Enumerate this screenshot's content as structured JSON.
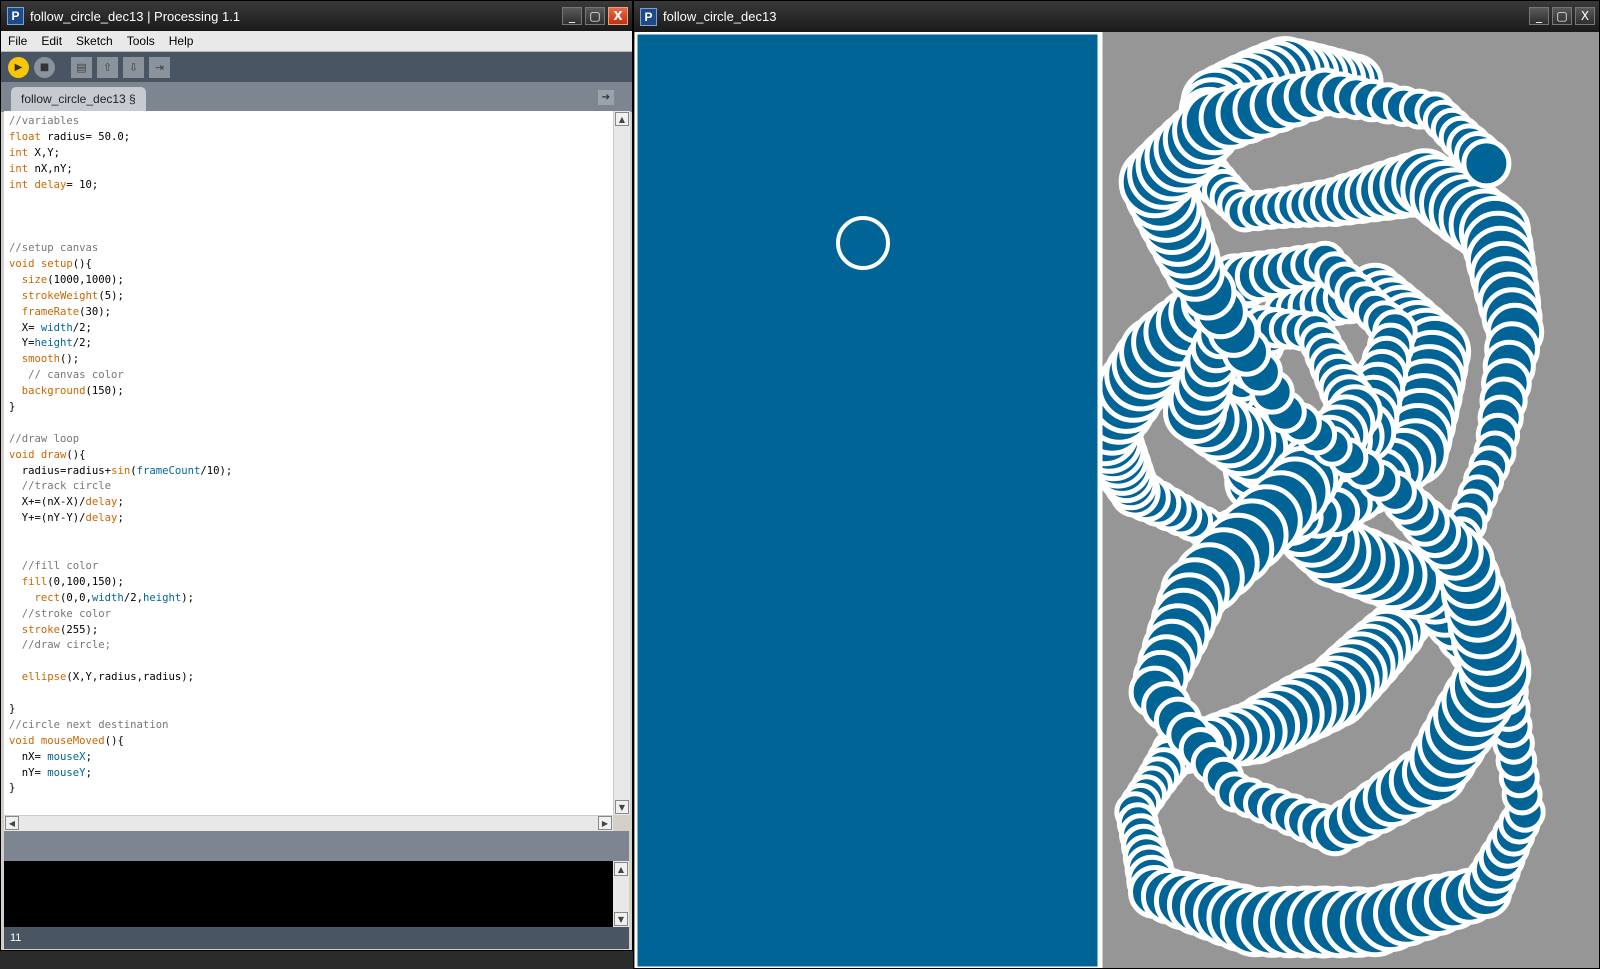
{
  "editor_window": {
    "title": "follow_circle_dec13 | Processing 1.1",
    "logo_letter": "P",
    "controls": {
      "minimize": "_",
      "maximize": "▢",
      "close": "X"
    },
    "menu": [
      "File",
      "Edit",
      "Sketch",
      "Tools",
      "Help"
    ],
    "toolbar": {
      "run": "▶",
      "stop": "■",
      "new": "▤",
      "open": "⇧",
      "save": "⇩",
      "export": "⇥"
    },
    "tab_label": "follow_circle_dec13 §",
    "tab_menu_glyph": "➔",
    "status_line_number": "11"
  },
  "code_lines": [
    [
      {
        "t": "//variables",
        "c": "c"
      }
    ],
    [
      {
        "t": "float",
        "c": "k"
      },
      {
        "t": " radius= 50.0;"
      }
    ],
    [
      {
        "t": "int",
        "c": "k"
      },
      {
        "t": " X,Y;"
      }
    ],
    [
      {
        "t": "int",
        "c": "k"
      },
      {
        "t": " nX,nY;"
      }
    ],
    [
      {
        "t": "int",
        "c": "k"
      },
      {
        "t": " delay",
        "c": "f"
      },
      {
        "t": "= 10;"
      }
    ],
    [],
    [],
    [],
    [
      {
        "t": "//setup canvas",
        "c": "c"
      }
    ],
    [
      {
        "t": "void",
        "c": "k"
      },
      {
        "t": " "
      },
      {
        "t": "setup",
        "c": "f"
      },
      {
        "t": "(){"
      }
    ],
    [
      {
        "t": "  "
      },
      {
        "t": "size",
        "c": "f"
      },
      {
        "t": "(1000,1000);"
      }
    ],
    [
      {
        "t": "  "
      },
      {
        "t": "strokeWeight",
        "c": "f"
      },
      {
        "t": "(5);"
      }
    ],
    [
      {
        "t": "  "
      },
      {
        "t": "frameRate",
        "c": "f"
      },
      {
        "t": "(30);"
      }
    ],
    [
      {
        "t": "  X= "
      },
      {
        "t": "width",
        "c": "v"
      },
      {
        "t": "/2;"
      }
    ],
    [
      {
        "t": "  Y="
      },
      {
        "t": "height",
        "c": "v"
      },
      {
        "t": "/2;"
      }
    ],
    [
      {
        "t": "  "
      },
      {
        "t": "smooth",
        "c": "f"
      },
      {
        "t": "();"
      }
    ],
    [
      {
        "t": "   // canvas color",
        "c": "c"
      }
    ],
    [
      {
        "t": "  "
      },
      {
        "t": "background",
        "c": "f"
      },
      {
        "t": "(150);"
      }
    ],
    [
      {
        "t": "}"
      }
    ],
    [],
    [
      {
        "t": "//draw loop",
        "c": "c"
      }
    ],
    [
      {
        "t": "void",
        "c": "k"
      },
      {
        "t": " "
      },
      {
        "t": "draw",
        "c": "f"
      },
      {
        "t": "(){"
      }
    ],
    [
      {
        "t": "  radius=radius+"
      },
      {
        "t": "sin",
        "c": "f"
      },
      {
        "t": "("
      },
      {
        "t": "frameCount",
        "c": "v"
      },
      {
        "t": "/10);"
      }
    ],
    [
      {
        "t": "  //track circle",
        "c": "c"
      }
    ],
    [
      {
        "t": "  X+=(nX-X)/"
      },
      {
        "t": "delay",
        "c": "f"
      },
      {
        "t": ";"
      }
    ],
    [
      {
        "t": "  Y+=(nY-Y)/"
      },
      {
        "t": "delay",
        "c": "f"
      },
      {
        "t": ";"
      }
    ],
    [],
    [],
    [
      {
        "t": "  //fill color",
        "c": "c"
      }
    ],
    [
      {
        "t": "  "
      },
      {
        "t": "fill",
        "c": "f"
      },
      {
        "t": "(0,100,150);"
      }
    ],
    [
      {
        "t": "    "
      },
      {
        "t": "rect",
        "c": "f"
      },
      {
        "t": "(0,0,"
      },
      {
        "t": "width",
        "c": "v"
      },
      {
        "t": "/2,"
      },
      {
        "t": "height",
        "c": "v"
      },
      {
        "t": ");"
      }
    ],
    [
      {
        "t": "  //stroke color",
        "c": "c"
      }
    ],
    [
      {
        "t": "  "
      },
      {
        "t": "stroke",
        "c": "f"
      },
      {
        "t": "(255);"
      }
    ],
    [
      {
        "t": "  //draw circle;",
        "c": "c"
      }
    ],
    [],
    [
      {
        "t": "  "
      },
      {
        "t": "ellipse",
        "c": "f"
      },
      {
        "t": "(X,Y,radius,radius);"
      }
    ],
    [],
    [
      {
        "t": "}"
      }
    ],
    [
      {
        "t": "//circle next destination",
        "c": "c"
      }
    ],
    [
      {
        "t": "void",
        "c": "k"
      },
      {
        "t": " "
      },
      {
        "t": "mouseMoved",
        "c": "f"
      },
      {
        "t": "(){"
      }
    ],
    [
      {
        "t": "  nX= "
      },
      {
        "t": "mouseX",
        "c": "v"
      },
      {
        "t": ";"
      }
    ],
    [
      {
        "t": "  nY= "
      },
      {
        "t": "mouseY",
        "c": "v"
      },
      {
        "t": ";"
      }
    ],
    [
      {
        "t": "}"
      }
    ]
  ],
  "sketch_window": {
    "title": "follow_circle_dec13",
    "logo_letter": "P",
    "controls": {
      "minimize": "_",
      "maximize": "▢",
      "close": "X"
    }
  },
  "colors": {
    "sketch_fill": "#006496",
    "sketch_background": "#969696",
    "stroke": "#ffffff",
    "run_button": "#f9c607",
    "toolbar": "#4a5563"
  }
}
